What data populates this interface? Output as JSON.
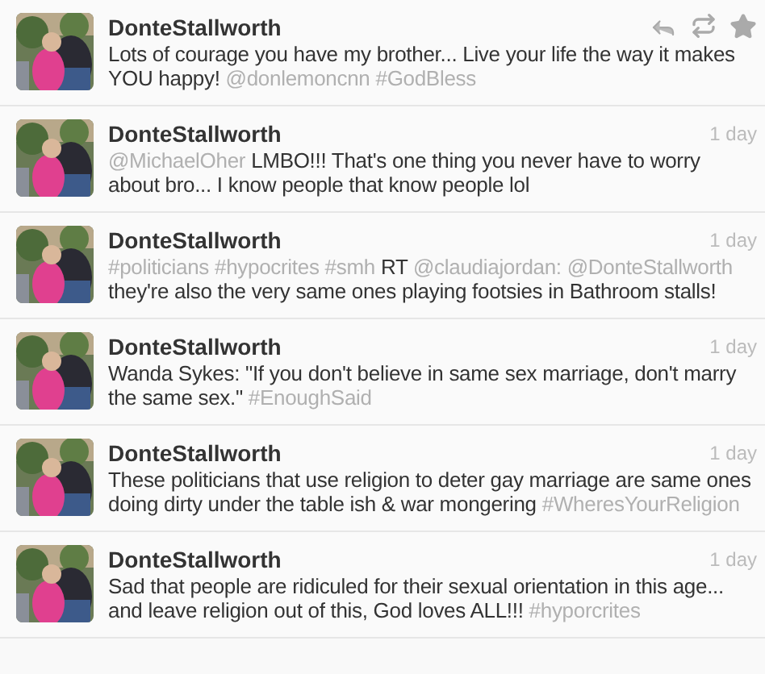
{
  "tweets": [
    {
      "name": "DonteStallworth",
      "hovered": true,
      "body": [
        {
          "kind": "text",
          "text": "Lots of courage you have my brother... Live your life the way it makes YOU happy!"
        },
        {
          "kind": "mention",
          "text": "@donlemoncnn"
        },
        {
          "kind": "hashtag",
          "text": "#GodBless"
        }
      ]
    },
    {
      "name": "DonteStallworth",
      "hovered": false,
      "time": "1 day",
      "body": [
        {
          "kind": "mention",
          "text": "@MichaelOher"
        },
        {
          "kind": "text",
          "text": "LMBO!!! That's one thing you never have to worry about bro... I know people that know people lol"
        }
      ]
    },
    {
      "name": "DonteStallworth",
      "hovered": false,
      "time": "1 day",
      "body": [
        {
          "kind": "hashtag",
          "text": "#politicians"
        },
        {
          "kind": "hashtag",
          "text": "#hypocrites"
        },
        {
          "kind": "hashtag",
          "text": "#smh"
        },
        {
          "kind": "text",
          "text": "RT"
        },
        {
          "kind": "mention",
          "text": "@claudiajordan:"
        },
        {
          "kind": "mention",
          "text": "@DonteStallworth"
        },
        {
          "kind": "text",
          "text": "they're also the very same ones playing footsies in Bathroom stalls!"
        }
      ]
    },
    {
      "name": "DonteStallworth",
      "hovered": false,
      "time": "1 day",
      "body": [
        {
          "kind": "text",
          "text": "Wanda Sykes: \"If you don't believe in same sex marriage, don't marry the same sex.\""
        },
        {
          "kind": "hashtag",
          "text": "#EnoughSaid"
        }
      ]
    },
    {
      "name": "DonteStallworth",
      "hovered": false,
      "time": "1 day",
      "body": [
        {
          "kind": "text",
          "text": "These politicians that use religion to deter gay marriage are same ones doing dirty under the table ish & war mongering"
        },
        {
          "kind": "hashtag",
          "text": "#WheresYourReligion"
        }
      ]
    },
    {
      "name": "DonteStallworth",
      "hovered": false,
      "time": "1 day",
      "body": [
        {
          "kind": "text",
          "text": "Sad that people are ridiculed for their sexual orientation in this age... and leave religion out of this, God loves ALL!!!"
        },
        {
          "kind": "hashtag",
          "text": "#hyporcrites"
        }
      ]
    }
  ]
}
